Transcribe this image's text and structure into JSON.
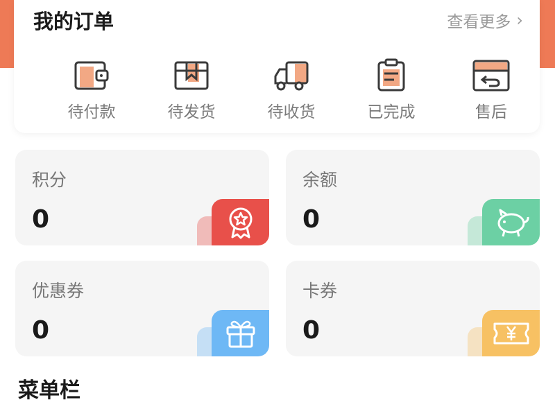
{
  "orders": {
    "title": "我的订单",
    "more": "查看更多",
    "items": [
      {
        "label": "待付款",
        "icon": "wallet-icon"
      },
      {
        "label": "待发货",
        "icon": "package-icon"
      },
      {
        "label": "待收货",
        "icon": "truck-icon"
      },
      {
        "label": "已完成",
        "icon": "clipboard-icon"
      },
      {
        "label": "售后",
        "icon": "return-icon"
      }
    ]
  },
  "stats": [
    {
      "label": "积分",
      "value": "0",
      "icon": "medal-icon",
      "color": "#e8504a"
    },
    {
      "label": "余额",
      "value": "0",
      "icon": "piggy-bank-icon",
      "color": "#6cd0a4"
    },
    {
      "label": "优惠券",
      "value": "0",
      "icon": "gift-icon",
      "color": "#6eb8f5"
    },
    {
      "label": "卡券",
      "value": "0",
      "icon": "yuan-ticket-icon",
      "color": "#f7c163"
    }
  ],
  "menu": {
    "title": "菜单栏"
  },
  "colors": {
    "brand": "#ee7a56",
    "accent_fill": "#f2a884"
  }
}
